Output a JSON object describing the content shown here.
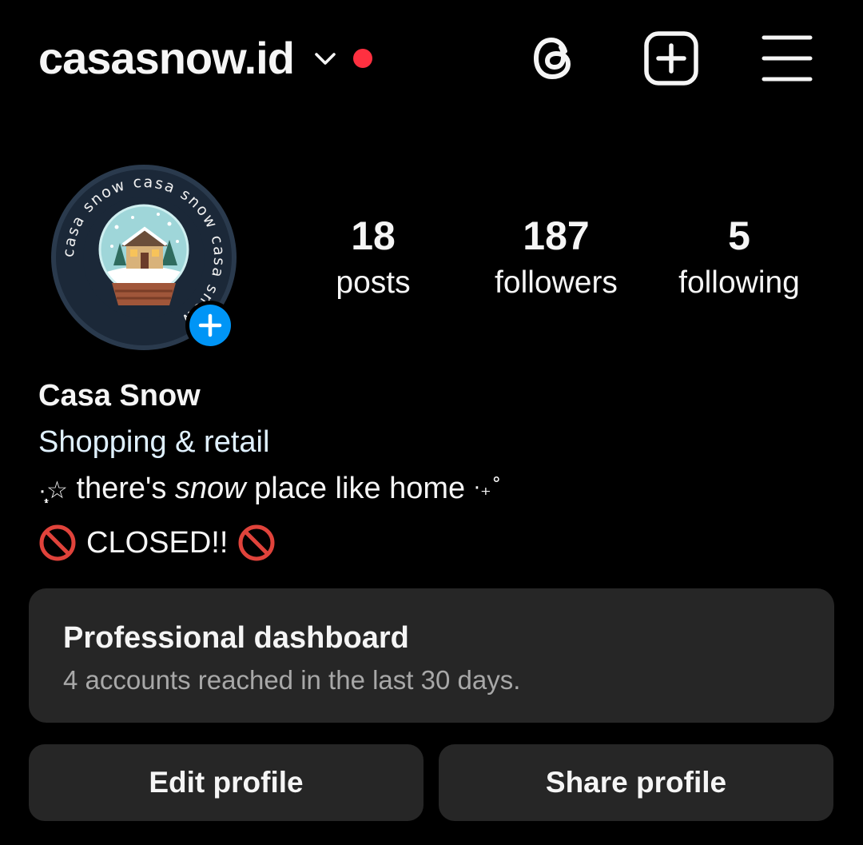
{
  "colors": {
    "background": "#000000",
    "text_primary": "#f5f5f5",
    "text_secondary": "#a8a8a8",
    "category_text": "#e0f1ff",
    "card_bg": "#262626",
    "notification_dot": "#ff3040",
    "add_badge": "#0095f6",
    "no_entry": "#e0433b"
  },
  "header": {
    "username": "casasnow.id",
    "icons": {
      "switch_account": "chevron-down-icon",
      "notification": "notification-dot",
      "threads": "threads-icon",
      "create": "plus-square-icon",
      "menu": "hamburger-menu-icon"
    }
  },
  "profile": {
    "avatar": {
      "ring_text": "casa snow casa snow casa snow",
      "icon": "snow-globe-house-logo"
    },
    "stats": [
      {
        "value": "18",
        "label": "posts"
      },
      {
        "value": "187",
        "label": "followers"
      },
      {
        "value": "5",
        "label": "following"
      }
    ]
  },
  "bio": {
    "name": "Casa Snow",
    "category": "Shopping & retail",
    "line": {
      "prefix": "·̩͙☆",
      "before": " there's ",
      "emphasis": "snow",
      "after": " place like home ",
      "suffix": "·₊˚"
    },
    "status": {
      "text": "CLOSED!!",
      "icon": "no-entry-icon"
    }
  },
  "dashboard": {
    "title": "Professional dashboard",
    "subtitle": "4 accounts reached in the last 30 days."
  },
  "buttons": {
    "edit": "Edit profile",
    "share": "Share profile"
  }
}
